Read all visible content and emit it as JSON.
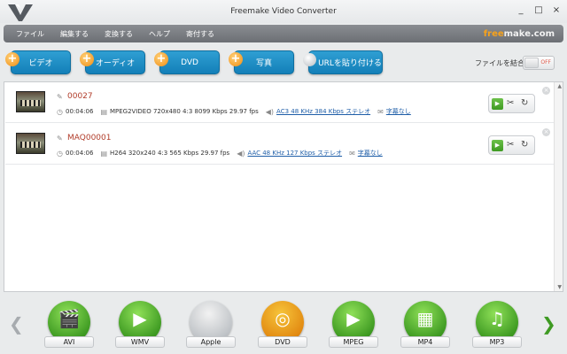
{
  "window": {
    "title": "Freemake Video Converter",
    "minimize": "_",
    "maximize": "□",
    "close": "×"
  },
  "menu": {
    "items": [
      "ファイル",
      "編集する",
      "変換する",
      "ヘルプ",
      "寄付する"
    ]
  },
  "brand": {
    "prefix": "free",
    "suffix": "make.com"
  },
  "toolbar": {
    "video_label": "ビデオ",
    "audio_label": "オーディオ",
    "dvd_label": "DVD",
    "photo_label": "写真",
    "url_label": "URLを貼り付ける",
    "join_label": "ファイルを結合",
    "toggle_state": "OFF"
  },
  "files": [
    {
      "name": "00027",
      "duration": "00:04:06",
      "video": "MPEG2VIDEO  720x480  4:3  8099 Kbps  29.97 fps",
      "audio": "AC3  48 KHz  384 Kbps  ステレオ",
      "subtitles": "字幕なし"
    },
    {
      "name": "MAQ00001",
      "duration": "00:04:06",
      "video": "H264  320x240  4:3  565 Kbps  29.97 fps",
      "audio": "AAC  48 KHz  127 Kbps  ステレオ",
      "subtitles": "字幕なし"
    }
  ],
  "formats": [
    "AVI",
    "WMV",
    "Apple",
    "DVD",
    "MPEG",
    "MP4",
    "MP3"
  ],
  "icons": {
    "plus": "+",
    "pencil": "✎",
    "clock": "◷",
    "film": "▤",
    "speaker": "◀)",
    "speech": "✉",
    "play": "▶",
    "scissors": "✂",
    "rotate": "↻",
    "remove": "×",
    "left": "❮",
    "right": "❯",
    "avi": "🎬",
    "wmv": "▶",
    "apple": "",
    "dvd": "◎",
    "mpeg": "▶",
    "mp4": "▦",
    "mp3": "♫"
  },
  "colors": {
    "accent_blue": "#1a8bc4",
    "accent_green": "#3e9a22",
    "file_name": "#b13c2a",
    "link": "#1f5ea8"
  }
}
